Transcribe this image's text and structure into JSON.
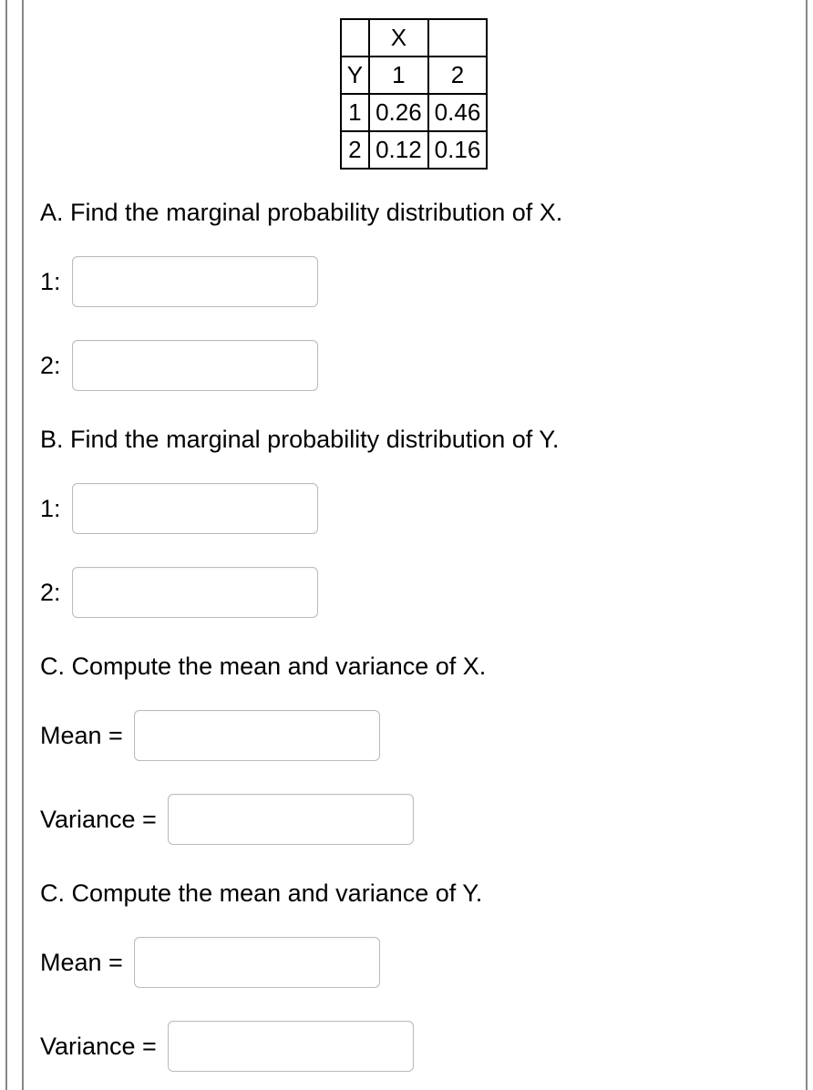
{
  "table": {
    "x_label": "X",
    "y_label": "Y",
    "col_headers": [
      "1",
      "2"
    ],
    "rows": [
      {
        "y": "1",
        "values": [
          "0.26",
          "0.46"
        ]
      },
      {
        "y": "2",
        "values": [
          "0.12",
          "0.16"
        ]
      }
    ]
  },
  "sectionA": {
    "prompt": "A. Find the marginal probability distribution of X.",
    "label1": "1:",
    "label2": "2:"
  },
  "sectionB": {
    "prompt": "B. Find the marginal probability distribution of Y.",
    "label1": "1:",
    "label2": "2:"
  },
  "sectionC_X": {
    "prompt": "C. Compute the mean and variance of X.",
    "mean_label": "Mean =",
    "variance_label": "Variance ="
  },
  "sectionC_Y": {
    "prompt": "C. Compute the mean and variance of Y.",
    "mean_label": "Mean =",
    "variance_label": "Variance ="
  }
}
